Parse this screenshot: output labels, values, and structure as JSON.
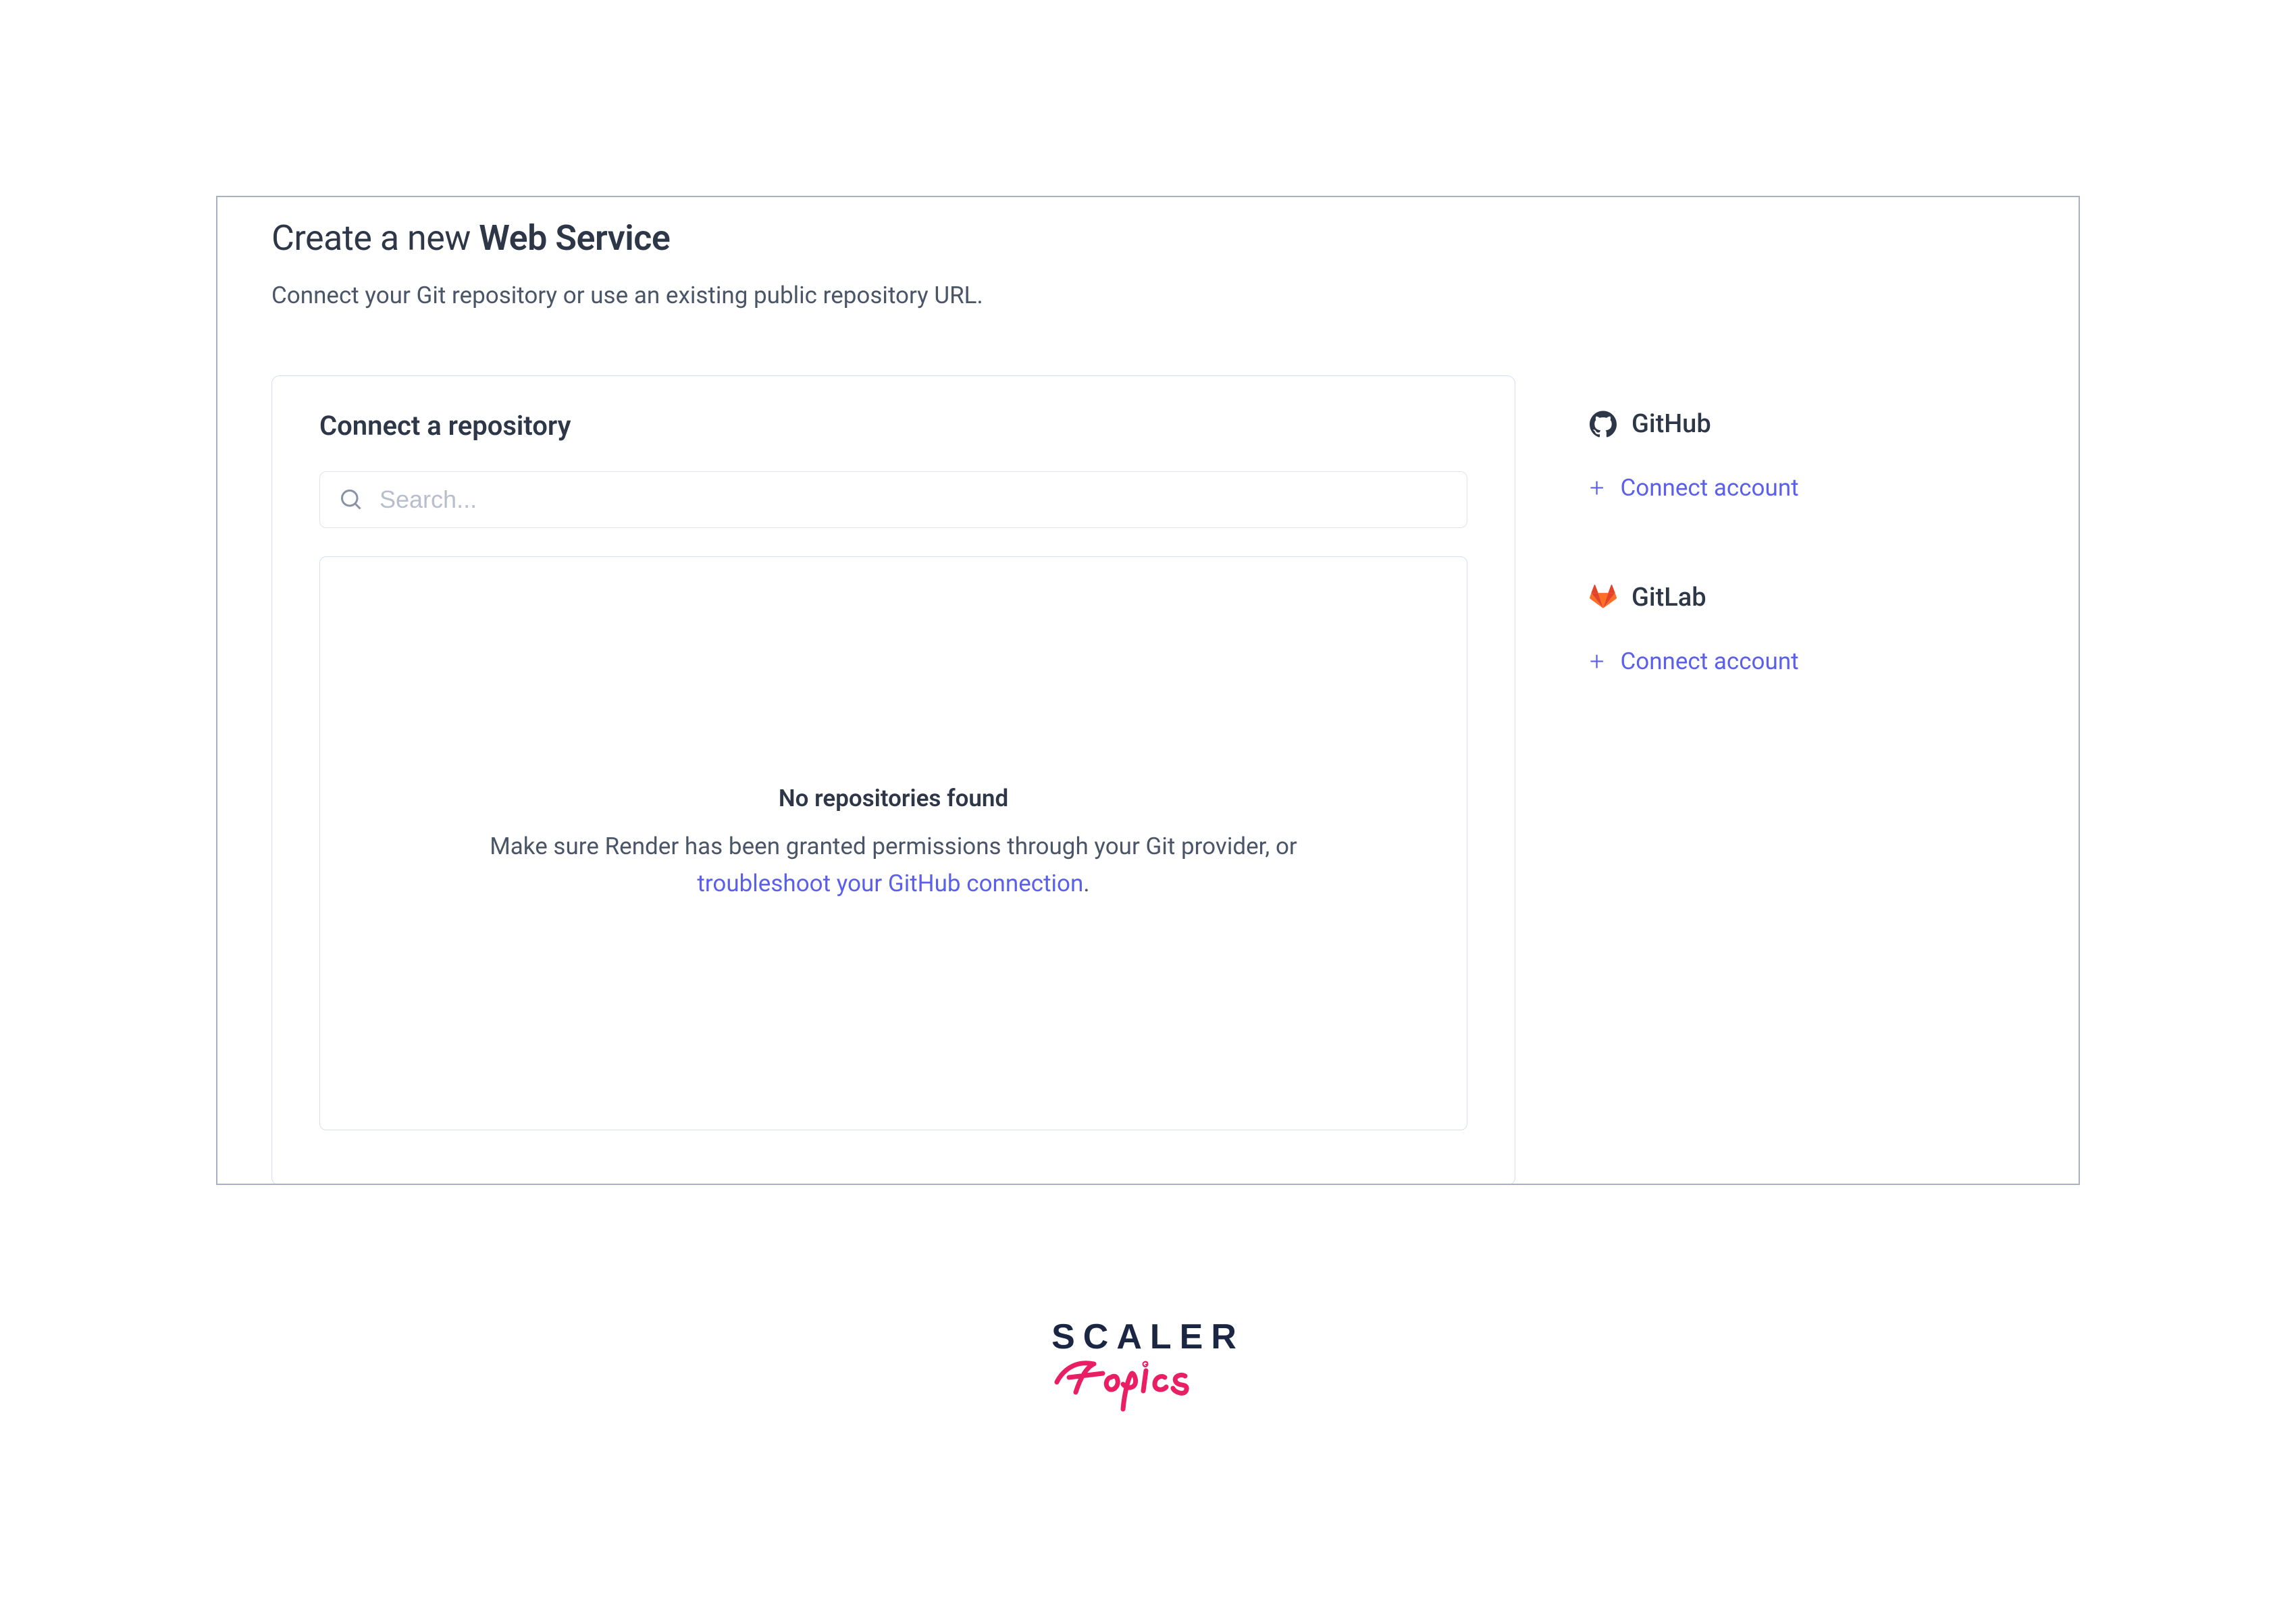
{
  "header": {
    "title_prefix": "Create a new ",
    "title_bold": "Web Service",
    "subtitle": "Connect your Git repository or use an existing public repository URL."
  },
  "panel": {
    "title": "Connect a repository",
    "search_placeholder": "Search...",
    "empty_title": "No repositories found",
    "empty_text_1": "Make sure Render has been granted permissions through your Git provider, or ",
    "empty_link": "troubleshoot your GitHub connection",
    "empty_text_2": "."
  },
  "providers": [
    {
      "name": "GitHub",
      "connect_label": "Connect account"
    },
    {
      "name": "GitLab",
      "connect_label": "Connect account"
    }
  ],
  "logo": {
    "line1": "SCALER",
    "line2": "Topics"
  }
}
